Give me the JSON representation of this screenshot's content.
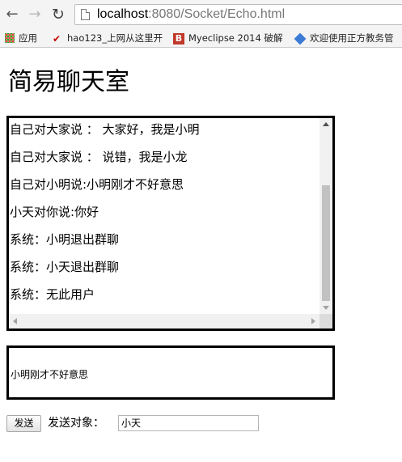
{
  "browser": {
    "url_host": "localhost",
    "url_rest": ":8080/Socket/Echo.html",
    "bookmarks": [
      {
        "label": "应用",
        "icon": "apps-grid-icon"
      },
      {
        "label": "hao123_上网从这里开",
        "icon": "hao123-icon"
      },
      {
        "label": "Myeclipse 2014 破解",
        "icon": "myeclipse-icon"
      },
      {
        "label": "欢迎使用正方教务管",
        "icon": "zhengfang-icon"
      }
    ]
  },
  "page": {
    "title": "简易聊天室"
  },
  "chat": {
    "messages": [
      "自己对大家说 ： 大家好，我是小明",
      "自己对大家说 ： 说错，我是小龙",
      "自己对小明说:小明刚才不好意思",
      "小天对你说:你好",
      "系统：小明退出群聊",
      "系统：小天退出群聊",
      "系统：无此用户"
    ]
  },
  "compose": {
    "text": "小明刚才不好意思"
  },
  "controls": {
    "send_label": "发送",
    "target_label": "发送对象：",
    "target_value": "小天"
  }
}
